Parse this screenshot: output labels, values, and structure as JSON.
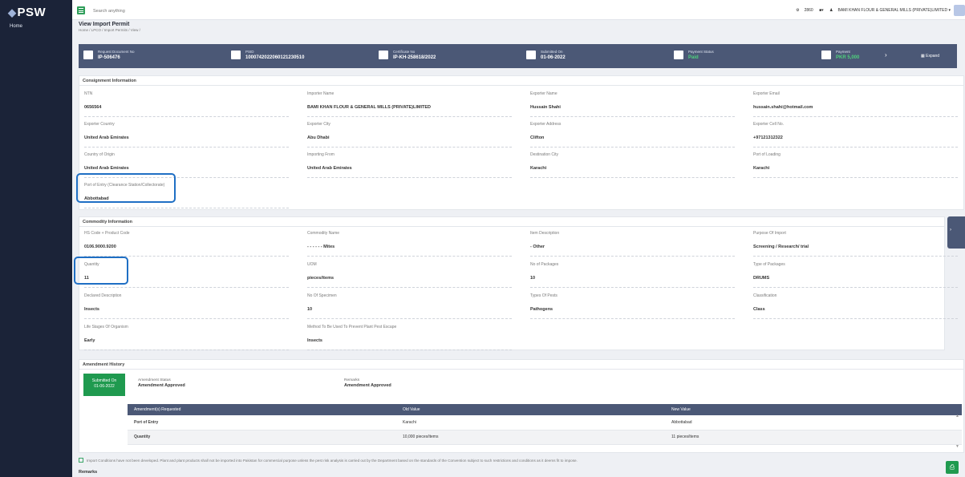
{
  "app": {
    "logo": "PSW",
    "nav_home": "Home"
  },
  "topbar": {
    "search_placeholder": "Search anything",
    "points": "2860",
    "user": "BAMI KHAN FLOUR & GENERAL MILLS (PRIVATE)LIMITED ▾"
  },
  "page": {
    "title": "View Import Permit",
    "breadcrumb": "Home / LPCO / Import Permits / View /"
  },
  "strip": {
    "request_no_label": "Request Document No",
    "request_no": "IP-506476",
    "psid_label": "PSID",
    "psid": "1000742022060121230510",
    "certificate_label": "Certificate No",
    "certificate": "IP-KH-258618/2022",
    "submitted_label": "Submitted On",
    "submitted": "01-06-2022",
    "payment_status_label": "Payment Status",
    "payment_status": "Paid",
    "payment_label": "Payment",
    "payment": "PKR 5,000",
    "expand": "Expand"
  },
  "consignment": {
    "title": "Consignment Information",
    "fields": [
      {
        "label": "NTN",
        "value": "0656564"
      },
      {
        "label": "Importer Name",
        "value": "BAMI KHAN FLOUR & GENERAL MILLS (PRIVATE)LIMITED"
      },
      {
        "label": "Exporter Name",
        "value": "Hussain Shahi"
      },
      {
        "label": "Exporter Email",
        "value": "hussain.shahi@hotmail.com"
      },
      {
        "label": "Exporter Country",
        "value": "United Arab Emirates"
      },
      {
        "label": "Exporter City",
        "value": "Abu Dhabi"
      },
      {
        "label": "Exporter Address",
        "value": "Clifton"
      },
      {
        "label": "Exporter Cell No.",
        "value": "+97121312322"
      },
      {
        "label": "Country of Origin",
        "value": "United Arab Emirates"
      },
      {
        "label": "Importing From",
        "value": "United Arab Emirates"
      },
      {
        "label": "Destination City",
        "value": "Karachi"
      },
      {
        "label": "Port of Loading",
        "value": "Karachi"
      },
      {
        "label": "Port of Entry (Clearance Station/Collectorate)",
        "value": "Abbottabad"
      }
    ]
  },
  "commodity": {
    "title": "Commodity Information",
    "fields": [
      {
        "label": "HS Code + Product Code",
        "value": "0106.9000.9200"
      },
      {
        "label": "Commodity Name",
        "value": "- - - - - - Mites"
      },
      {
        "label": "Item Description",
        "value": "- Other"
      },
      {
        "label": "Purpose Of Import",
        "value": "Screening / Research/ trial"
      },
      {
        "label": "Quantity",
        "value": "11"
      },
      {
        "label": "UOM",
        "value": "pieces/items"
      },
      {
        "label": "No of Packages",
        "value": "10"
      },
      {
        "label": "Type of Packages",
        "value": "DRUMS"
      },
      {
        "label": "Declared Description",
        "value": "Insects"
      },
      {
        "label": "No Of Specimen",
        "value": "10"
      },
      {
        "label": "Types Of Pests",
        "value": "Pathogens"
      },
      {
        "label": "Classification",
        "value": "Class"
      },
      {
        "label": "Life Stages Of Organism",
        "value": "Early"
      },
      {
        "label": "Method To Be Used To Prevent Plant Pest Escape",
        "value": "Insects"
      }
    ]
  },
  "amendment": {
    "title": "Amendment History",
    "submitted_label": "Submitted On",
    "submitted": "01-06-2022",
    "status_label": "Amendment Status",
    "status": "Amendment Approved",
    "remarks_label": "Remarks",
    "remarks": "Amendment Approved",
    "headers": [
      "Amendment(s) Requested",
      "Old Value",
      "New Value"
    ],
    "rows": [
      [
        "Port of Entry",
        "Karachi",
        "Abbottabad"
      ],
      [
        "Quantity",
        "10,000 pieces/items",
        "11 pieces/items"
      ]
    ]
  },
  "conditions": "Import Conditions have not been developed. Plant and plant products shall not be imported into Pakistan for commercial purpose unless the pest risk analysis is carried out by the Department based on the standards of the Convention subject to such restrictions and conditions as it deems fit to impose.",
  "remarks_title": "Remarks",
  "colors": {
    "sidebar": "#1b2338",
    "strip": "#4b5876",
    "accent_green": "#1f9a4f",
    "highlight": "#1f6fc4"
  }
}
